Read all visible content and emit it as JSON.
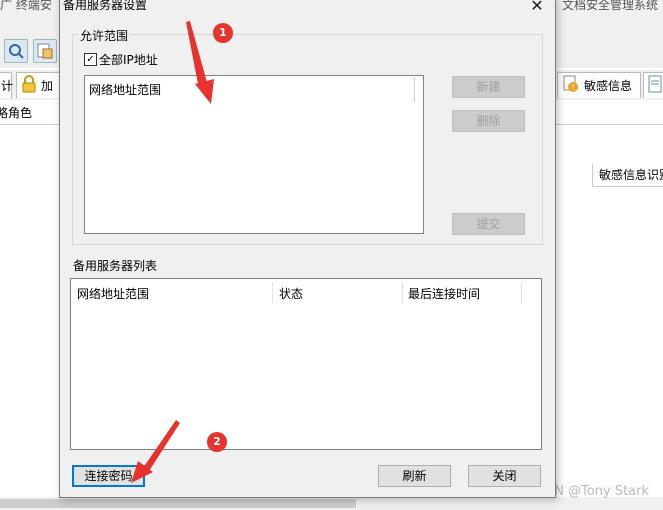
{
  "background_app": {
    "title_fragments": [
      "广 终端安",
      "文档安全管理系统"
    ],
    "tabs": [
      {
        "label": "计",
        "icon": "document-icon"
      },
      {
        "label": "加",
        "icon": "lock-icon"
      },
      {
        "label": "敏感信息",
        "icon": "warning-icon"
      },
      {
        "label": "",
        "icon": "document-icon"
      }
    ],
    "subrow_text": "略角色",
    "column_header": "敏感信息识别",
    "toolbar_icons": [
      "search-icon",
      "edit-icon"
    ]
  },
  "dialog": {
    "title": "备用服务器设置",
    "close_glyph": "✕",
    "allowed_range": {
      "legend": "允许范围",
      "all_ip_label": "全部IP地址",
      "all_ip_checked": true,
      "check_glyph": "✓",
      "list_items": [
        "网络地址范围"
      ],
      "buttons": {
        "new": "新建",
        "delete": "删除",
        "submit": "提交"
      }
    },
    "server_list": {
      "caption": "备用服务器列表",
      "columns": [
        "网络地址范围",
        "状态",
        "最后连接时间"
      ],
      "rows": []
    },
    "buttons": {
      "connect_password": "连接密码",
      "refresh": "刷新",
      "close": "关闭"
    }
  },
  "annotations": {
    "markers": [
      "1",
      "2"
    ],
    "color": "#e8322b"
  },
  "watermark": "CSDN @Tony Stark"
}
